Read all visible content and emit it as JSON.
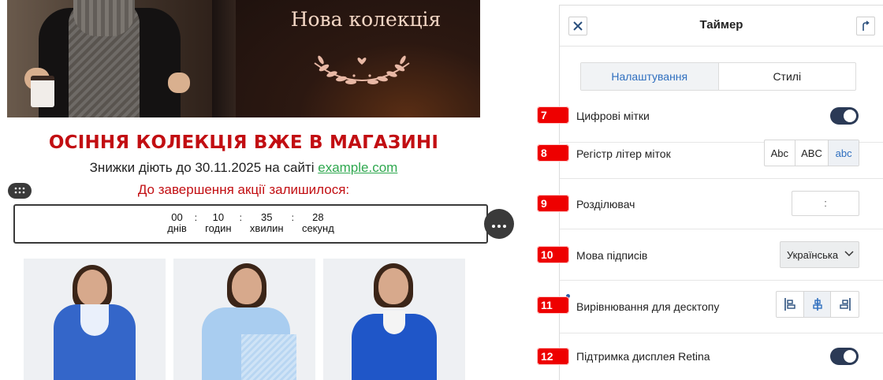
{
  "email": {
    "hero_title": "Нова колекція",
    "headline": "ОСІННЯ КОЛЕКЦІЯ ВЖЕ В МАГАЗИНІ",
    "subline_text": "Знижки діють до 30.11.2025 на сайті ",
    "subline_link": "example.com",
    "remaining_text": "До завершення акції залишилося:",
    "timer": {
      "units": [
        {
          "value": "00",
          "label": "днів"
        },
        {
          "value": "10",
          "label": "годин"
        },
        {
          "value": "35",
          "label": "хвилин"
        },
        {
          "value": "28",
          "label": "секунд"
        }
      ],
      "separator": ":"
    },
    "products": [
      {
        "coat_color": "#3466c9"
      },
      {
        "coat_color": "#a9cdf0"
      },
      {
        "coat_color": "#1f56c8"
      }
    ]
  },
  "panel": {
    "title": "Таймер",
    "tabs": [
      {
        "label": "Налаштування",
        "active": true
      },
      {
        "label": "Стилі",
        "active": false
      }
    ],
    "rows": [
      {
        "badge": "7",
        "label": "Цифрові мітки",
        "control": "toggle",
        "on": true
      },
      {
        "badge": "8",
        "label": "Регістр літер міток",
        "control": "segmented",
        "options": [
          "Abc",
          "ABC",
          "abc"
        ],
        "selected": 2
      },
      {
        "badge": "9",
        "label": "Розділювач",
        "control": "input",
        "value": ":"
      },
      {
        "badge": "10",
        "label": "Мова підписів",
        "control": "select",
        "value": "Українська"
      },
      {
        "badge": "11",
        "label": "Вирівнювання для десктопу",
        "control": "align",
        "options": [
          "align-left-icon",
          "align-center-icon",
          "align-right-icon"
        ],
        "selected": 1
      },
      {
        "badge": "12",
        "label": "Підтримка дисплея Retina",
        "control": "toggle",
        "on": true
      }
    ]
  },
  "colors": {
    "accent_red": "#c20e12",
    "link_green": "#2fa84f",
    "toggle_on": "#2b3a56",
    "tab_active": "#2f6fbf",
    "badge_red": "#ee0000"
  }
}
